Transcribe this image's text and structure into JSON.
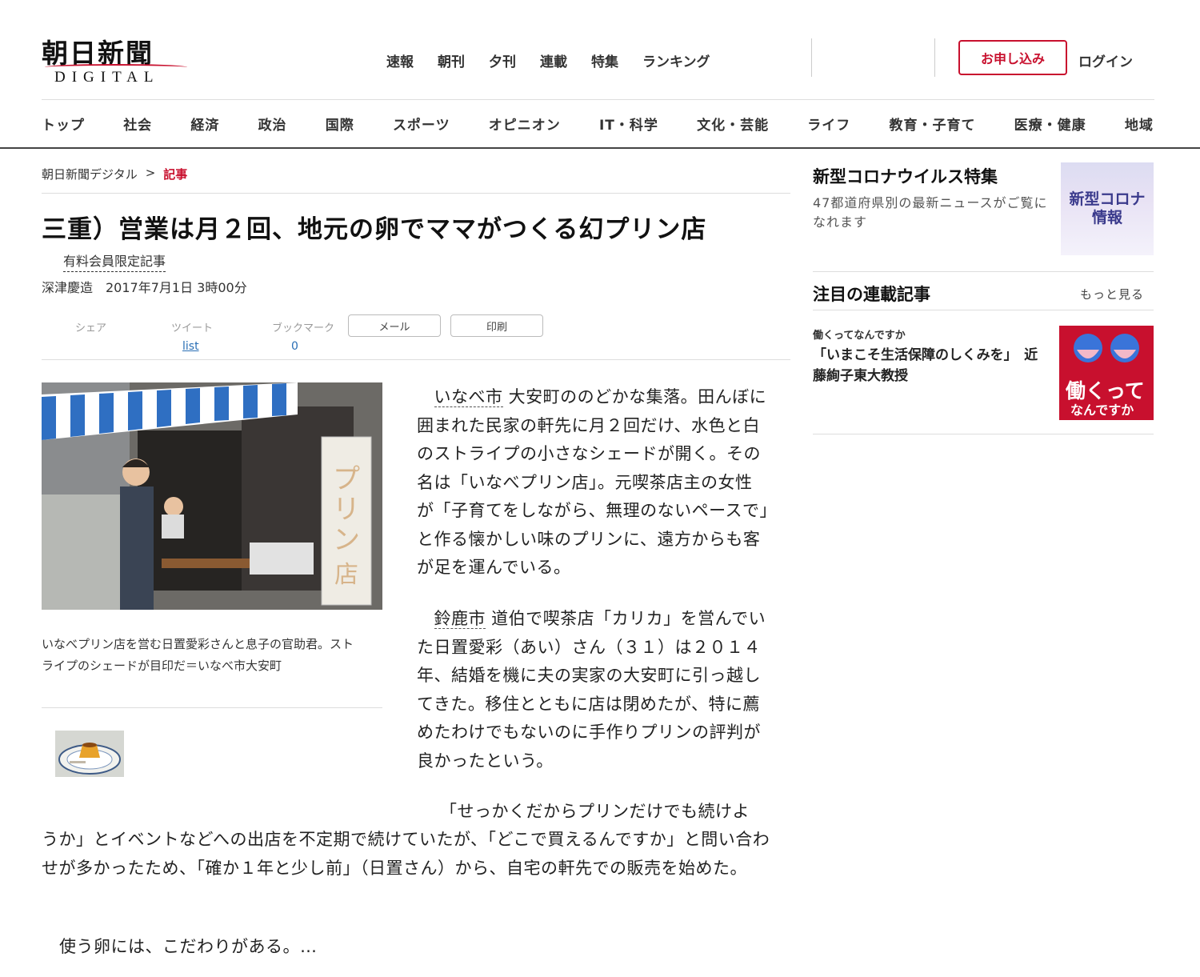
{
  "header": {
    "logo_jp": "朝日新聞",
    "logo_en": "DIGITAL",
    "top_nav": [
      "速報",
      "朝刊",
      "夕刊",
      "連載",
      "特集",
      "ランキング"
    ],
    "apply_label": "お申し込み",
    "login_label": "ログイン",
    "main_nav": [
      "トップ",
      "社会",
      "経済",
      "政治",
      "国際",
      "スポーツ",
      "オピニオン",
      "IT・科学",
      "文化・芸能",
      "ライフ",
      "教育・子育て",
      "医療・健康",
      "地域"
    ]
  },
  "breadcrumb": {
    "home": "朝日新聞デジタル",
    "sep": ">",
    "current": "記事"
  },
  "article": {
    "headline": "三重）営業は月２回、地元の卵でママがつくる幻プリン店",
    "members_label": "有料会員限定記事",
    "byline": "深津慶造　2017年7月1日 3時00分",
    "share": {
      "share_label": "シェア",
      "tweet_label": "ツイート",
      "bookmark_label": "ブックマーク",
      "mail_label": "メール",
      "print_label": "印刷",
      "tweet_count": "list",
      "bookmark_count": "0"
    },
    "photo_sign_text": "プリン店",
    "caption": "いなべプリン店を営む日置愛彩さんと息子の官助君。ストライプのシェードが目印だ＝いなべ市大安町",
    "p1_link": "いなべ市",
    "p1_text": " 大安町ののどかな集落。田んぼに囲まれた民家の軒先に月２回だけ、水色と白のストライプの小さなシェードが開く。その名は「いなべプリン店」。元喫茶店主の女性が「子育てをしながら、無理のないペースで」と作る懐かしい味のプリンに、遠方からも客が足を運んでいる。",
    "p2_link": "鈴鹿市",
    "p2_text": " 道伯で喫茶店「カリカ」を営んでいた日置愛彩（あい）さん（３１）は２０１４年、結婚を機に夫の実家の大安町に引っ越してきた。移住とともに店は閉めたが、特に薦めたわけでもないのに手作りプリンの評判が良かったという。",
    "p3_first": "「せっかくだからプリンだけでも続けよ",
    "p3_rest": "うか」とイベントなどへの出店を不定期で続けていたが、「どこで買えるんですか」と問い合わせが多かったため、「確か１年と少し前」（日置さん）から、自宅の軒先での販売を始めた。",
    "p4": "使う卵には、こだわりがある。…"
  },
  "sidebar": {
    "covid_title": "新型コロナウイルス特集",
    "covid_desc": "47都道府県別の最新ニュースがご覧になれます",
    "covid_img_line1": "新型コロナ",
    "covid_img_line2": "情報",
    "series_title": "注目の連載記事",
    "more_label": "もっと見る",
    "series_category": "働くってなんですか",
    "series_headline": "「いまこそ生活保障のしくみを」　近藤絢子東大教授",
    "series_img_line1": "働くって",
    "series_img_line2": "なんですか"
  }
}
